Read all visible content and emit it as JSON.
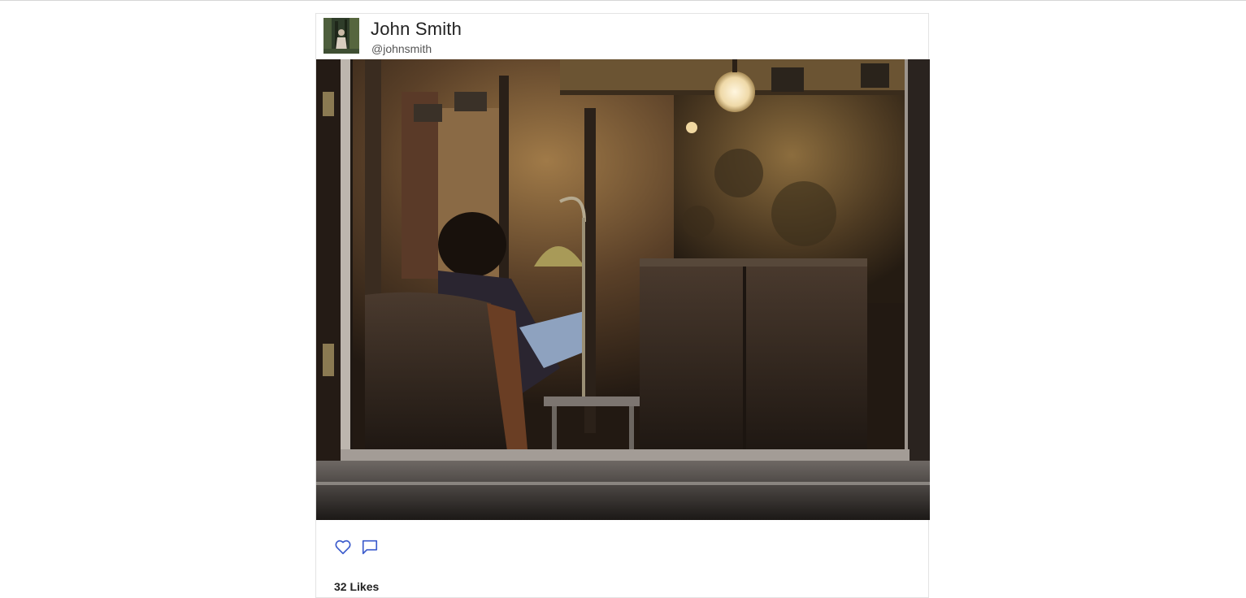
{
  "post": {
    "author": {
      "name": "John Smith",
      "handle": "@johnsmith",
      "avatar_icon": "profile-photo"
    },
    "image": {
      "description_icon": "photo"
    },
    "actions": {
      "like_icon": "heart-icon",
      "comment_icon": "comment-icon",
      "accent_color": "#3b5bcc"
    },
    "likes_label": "32 Likes"
  }
}
